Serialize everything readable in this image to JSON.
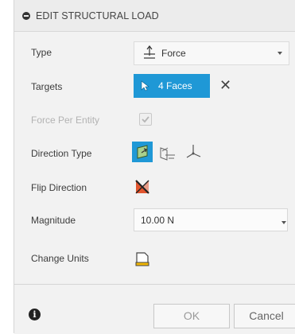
{
  "header": {
    "title": "EDIT STRUCTURAL LOAD"
  },
  "rows": {
    "type": {
      "label": "Type",
      "value": "Force"
    },
    "targets": {
      "label": "Targets",
      "value": "4 Faces"
    },
    "force_per_entity": {
      "label": "Force Per Entity",
      "checked": true
    },
    "direction_type": {
      "label": "Direction Type"
    },
    "flip_direction": {
      "label": "Flip Direction"
    },
    "magnitude": {
      "label": "Magnitude",
      "value": "10.00 N"
    },
    "change_units": {
      "label": "Change Units"
    }
  },
  "footer": {
    "ok_label": "OK",
    "cancel_label": "Cancel"
  },
  "colors": {
    "accent": "#1f98d6",
    "flip_icon": "#e1562f"
  }
}
